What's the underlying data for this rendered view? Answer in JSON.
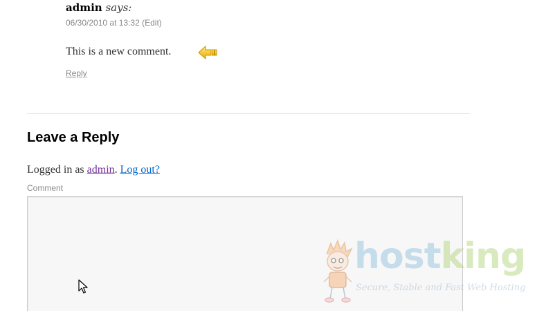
{
  "comment": {
    "author": "admin",
    "says": "says:",
    "date": "06/30/2010 at 13:32",
    "edit_label": "Edit",
    "body": "This is a new comment.",
    "reply_label": "Reply"
  },
  "reply_form": {
    "title": "Leave a Reply",
    "logged_in_prefix": "Logged in as ",
    "user": "admin",
    "separator": ". ",
    "logout_label": "Log out?",
    "comment_label": "Comment",
    "comment_value": ""
  },
  "watermark": {
    "brand_part1": "host",
    "brand_part2": "king",
    "tagline": "Secure, Stable and Fast Web Hosting"
  },
  "colors": {
    "user_link": "#743399",
    "logout_link": "#0066cc",
    "arrow_icon": "#f4c430"
  }
}
